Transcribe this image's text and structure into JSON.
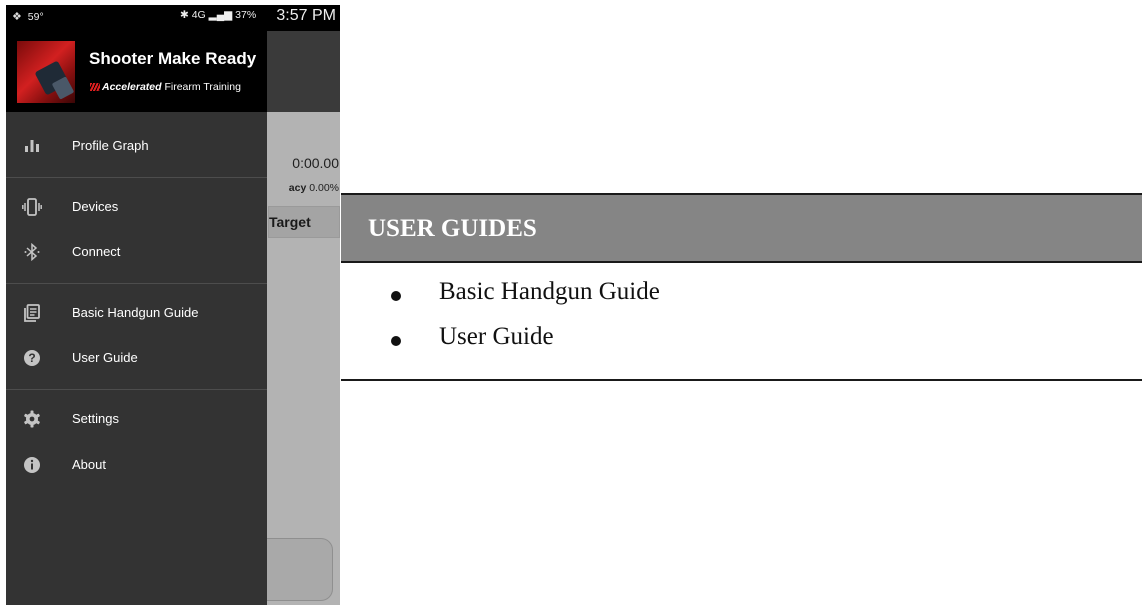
{
  "status_bar": {
    "temperature": "59°",
    "signal_indicators": "✱ 4G ▂▄▆ 37%",
    "time": "3:57 PM"
  },
  "background_app": {
    "timer": "0:00.00",
    "accuracy_label": "acy",
    "accuracy_value": "0.00%",
    "tab_label": "Target"
  },
  "drawer": {
    "app_title": "Shooter Make Ready",
    "tagline_brand": "Accelerated",
    "tagline_rest": "Firearm Training",
    "items": [
      {
        "label": "Profile Graph",
        "icon": "bar-chart-icon"
      },
      {
        "label": "Devices",
        "icon": "vibrate-device-icon"
      },
      {
        "label": "Connect",
        "icon": "bluetooth-icon"
      },
      {
        "label": "Basic Handgun Guide",
        "icon": "document-icon"
      },
      {
        "label": "User Guide",
        "icon": "help-icon"
      },
      {
        "label": "Settings",
        "icon": "gear-icon"
      },
      {
        "label": "About",
        "icon": "info-icon"
      }
    ]
  },
  "user_guides": {
    "title": "USER GUIDES",
    "items": [
      "Basic Handgun Guide",
      "User Guide"
    ]
  }
}
